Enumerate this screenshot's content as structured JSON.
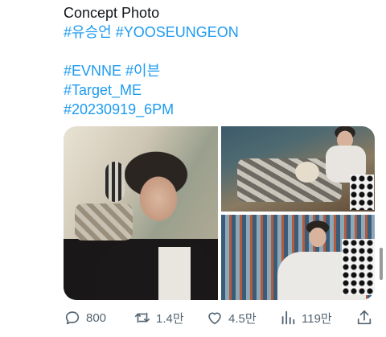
{
  "tweet": {
    "line1": "Concept Photo",
    "line2": [
      "#유승언",
      "#YOOSEUNGEON"
    ],
    "line3": [
      "#EVNNE",
      "#이븐"
    ],
    "line4": "#Target_ME",
    "line5": "#20230919_6PM"
  },
  "actions": {
    "reply_count": "800",
    "retweet_count": "1.4만",
    "like_count": "4.5만",
    "view_count": "119만"
  },
  "colors": {
    "hashtag": "#1d9bf0",
    "icon": "#536471",
    "text": "#0f1419"
  },
  "icons": [
    "reply-icon",
    "retweet-icon",
    "like-icon",
    "views-icon",
    "share-icon"
  ]
}
